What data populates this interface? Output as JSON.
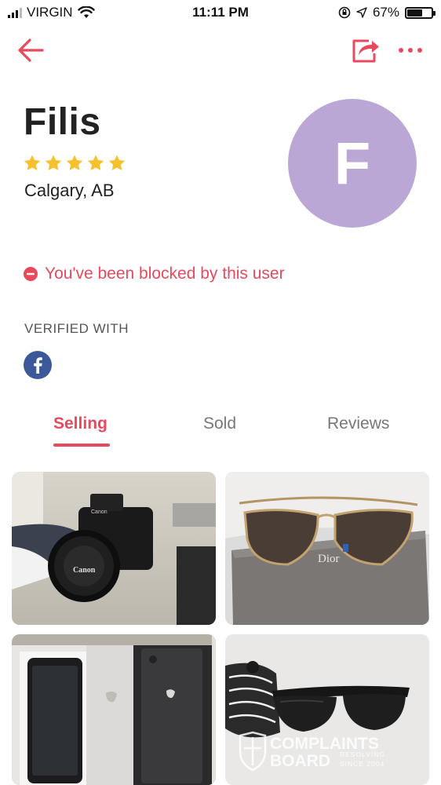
{
  "status_bar": {
    "carrier": "VIRGIN",
    "time": "11:11 PM",
    "battery_percent": "67%",
    "battery_level": 0.67,
    "icons": [
      "signal-icon",
      "wifi-icon",
      "rotation-lock-icon",
      "location-arrow-icon",
      "battery-icon"
    ]
  },
  "nav": {
    "icons": [
      "back-arrow-icon",
      "share-icon",
      "more-options-icon"
    ],
    "accent_color": "#e8495d"
  },
  "profile": {
    "name": "Filis",
    "rating": 5,
    "rating_max": 5,
    "location": "Calgary, AB",
    "avatar_initial": "F",
    "avatar_color": "#bba7d6",
    "star_color": "#f7c12d"
  },
  "blocked_notice": {
    "text": "You've been blocked by this user",
    "color": "#e8495d"
  },
  "verified": {
    "label": "VERIFIED WITH",
    "providers": [
      "facebook-icon"
    ]
  },
  "tabs": [
    {
      "label": "Selling",
      "active": true
    },
    {
      "label": "Sold",
      "active": false
    },
    {
      "label": "Reviews",
      "active": false
    }
  ],
  "listings": [
    {
      "name": "camera-photo",
      "brand_text": "Canon"
    },
    {
      "name": "sunglasses-photo",
      "brand_text": "Dior"
    },
    {
      "name": "phone-box-photo"
    },
    {
      "name": "black-sunglasses-photo"
    }
  ],
  "watermark": {
    "line1": "COMPLAINTS",
    "line2": "BOARD",
    "tagline1": "RESOLVING",
    "tagline2": "SINCE 2004"
  }
}
